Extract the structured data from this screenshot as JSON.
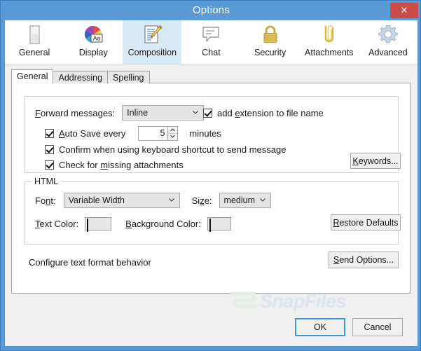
{
  "window": {
    "title": "Options",
    "close_label": "✕",
    "accent_color": "#5b9bd5",
    "close_color": "#cb4b4b"
  },
  "toolbar": {
    "items": [
      {
        "label": "General",
        "icon": "window-page-icon",
        "active": false
      },
      {
        "label": "Display",
        "icon": "color-wheel-aa-icon",
        "active": false
      },
      {
        "label": "Composition",
        "icon": "document-pencil-icon",
        "active": true
      },
      {
        "label": "Chat",
        "icon": "speech-bubble-icon",
        "active": false
      },
      {
        "label": "Security",
        "icon": "padlock-icon",
        "active": false
      },
      {
        "label": "Attachments",
        "icon": "paperclip-icon",
        "active": false
      },
      {
        "label": "Advanced",
        "icon": "gear-icon",
        "active": false
      }
    ]
  },
  "tabs": [
    {
      "label": "General",
      "active": true
    },
    {
      "label": "Addressing",
      "active": false
    },
    {
      "label": "Spelling",
      "active": false
    }
  ],
  "forward_group": {
    "forward_label": "Forward messages:",
    "forward_value": "Inline",
    "add_extension_label": "add extension to file name",
    "add_extension_checked": true,
    "auto_save_label": "Auto Save every",
    "auto_save_checked": true,
    "auto_save_value": "5",
    "minutes_label": "minutes",
    "confirm_label": "Confirm when using keyboard shortcut to send message",
    "confirm_checked": true,
    "check_missing_label": "Check for missing attachments",
    "check_missing_checked": true,
    "keywords_button": "Keywords..."
  },
  "html_group": {
    "title": "HTML",
    "font_label": "Font:",
    "font_value": "Variable Width",
    "size_label": "Size:",
    "size_value": "medium",
    "text_color_label": "Text Color:",
    "text_color_value": "#000000",
    "background_color_label": "Background Color:",
    "background_color_value": "#ffffff",
    "restore_defaults_button": "Restore Defaults"
  },
  "status": {
    "text": "Configure text format behavior",
    "send_options_button": "Send Options..."
  },
  "watermark": {
    "text": "SnapFiles"
  },
  "footer": {
    "ok_button": "OK",
    "cancel_button": "Cancel"
  }
}
